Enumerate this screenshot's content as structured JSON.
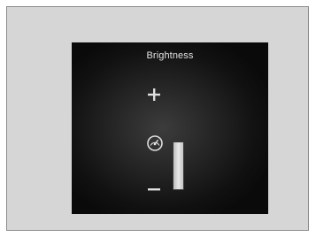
{
  "panel": {
    "title": "Brightness"
  },
  "controls": {
    "increase_icon": "plus-icon",
    "decrease_icon": "minus-icon",
    "auto_icon": "auto-brightness-dial-icon"
  },
  "brightness": {
    "level": 1.0
  },
  "colors": {
    "screen_background": "#141414",
    "text": "#e3e3e3",
    "frame_background": "#d6d6d6"
  }
}
